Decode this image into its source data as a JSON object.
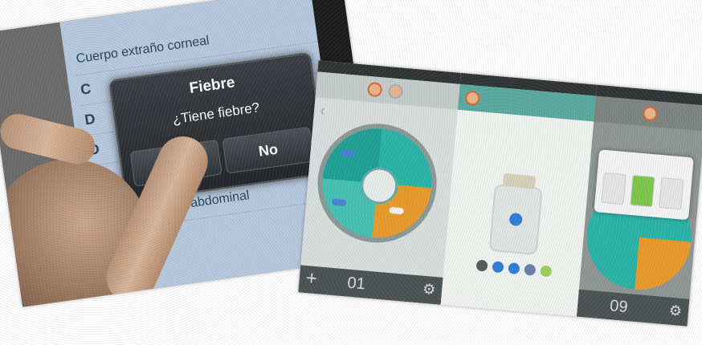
{
  "left_photo": {
    "list": {
      "items": [
        {
          "text": "Cuerpo extraño corneal"
        },
        {
          "text": "C"
        },
        {
          "text": "D"
        },
        {
          "text": "D"
        },
        {
          "text": "abdominal"
        }
      ]
    },
    "dialog": {
      "title": "Fiebre",
      "message": "¿Tiene fiebre?",
      "yes_label": "",
      "no_label": "No"
    }
  },
  "right_photo": {
    "screen1": {
      "bottom_number": "01",
      "plus_icon": "plus-icon",
      "gear_icon": "gear-icon",
      "wheel_colors": [
        "#2ab4a8",
        "#e99a2a",
        "#45c1b4",
        "#1fa196"
      ]
    },
    "screen2": {
      "bottle_color": "#2f7fd8",
      "color_options": [
        "#555a5c",
        "#2f7fd8",
        "#2f7fd8",
        "#6b7fae",
        "#9fd05a"
      ]
    },
    "screen3": {
      "bottom_number": "09",
      "popup_tiles": [
        "#e5e7e6",
        "#7cc74a",
        "#e5e7e6"
      ]
    }
  }
}
